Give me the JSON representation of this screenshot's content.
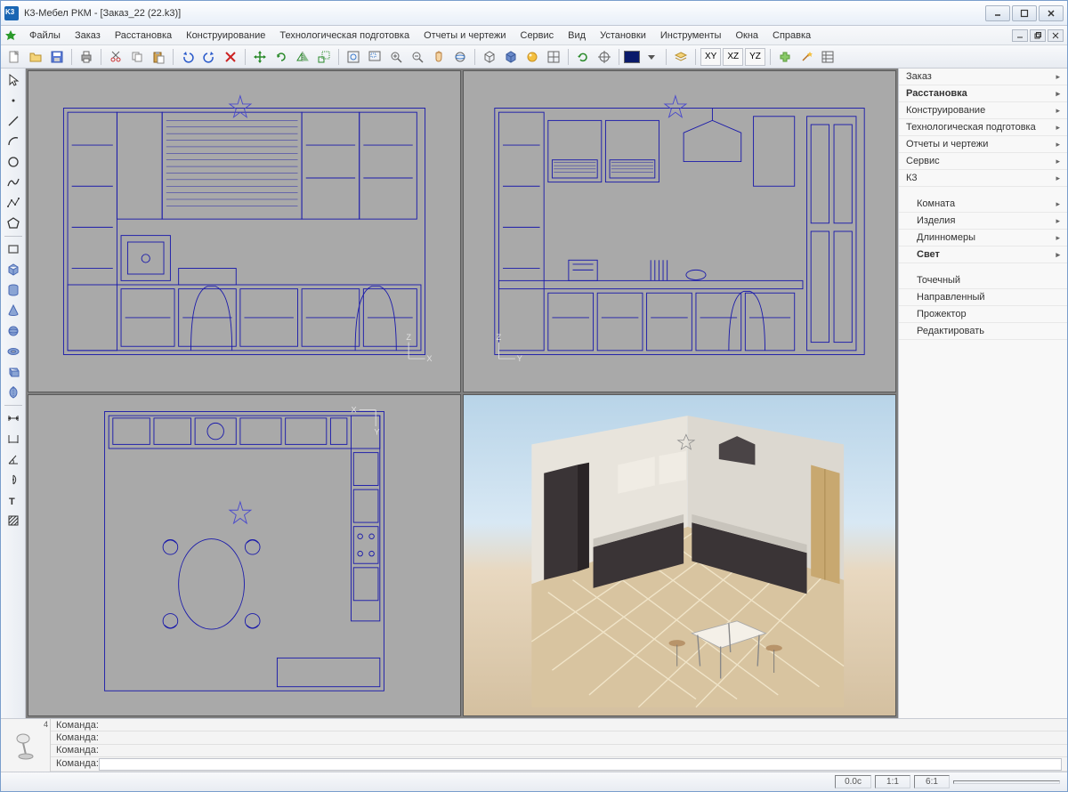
{
  "title": "К3-Мебел РКМ - [Заказ_22 (22.k3)]",
  "menu": [
    "Файлы",
    "Заказ",
    "Расстановка",
    "Конструирование",
    "Технологическая подготовка",
    "Отчеты и чертежи",
    "Сервис",
    "Вид",
    "Установки",
    "Инструменты",
    "Окна",
    "Справка"
  ],
  "axis_buttons": [
    "XY",
    "XZ",
    "YZ"
  ],
  "side": {
    "groups1": [
      {
        "label": "Заказ",
        "bold": false
      },
      {
        "label": "Расстановка",
        "bold": true
      },
      {
        "label": "Конструирование",
        "bold": false
      },
      {
        "label": "Технологическая подготовка",
        "bold": false
      },
      {
        "label": "Отчеты и чертежи",
        "bold": false
      },
      {
        "label": "Сервис",
        "bold": false
      },
      {
        "label": "К3",
        "bold": false
      }
    ],
    "groups2": [
      {
        "label": "Комната",
        "bold": false
      },
      {
        "label": "Изделия",
        "bold": false
      },
      {
        "label": "Длинномеры",
        "bold": false
      },
      {
        "label": "Свет",
        "bold": true
      }
    ],
    "groups3": [
      {
        "label": "Точечный"
      },
      {
        "label": "Направленный"
      },
      {
        "label": "Прожектор"
      },
      {
        "label": "Редактировать"
      }
    ]
  },
  "cmd_label": "Команда:",
  "bottom_num": "4",
  "status": {
    "time": "0.0c",
    "ratio1": "1:1",
    "ratio2": "6:1"
  },
  "viewport_axes": {
    "v1": {
      "h": "X",
      "v": "Z"
    },
    "v2": {
      "h": "Y",
      "v": "Z"
    },
    "v3": {
      "h": "X",
      "v": "Y"
    }
  }
}
